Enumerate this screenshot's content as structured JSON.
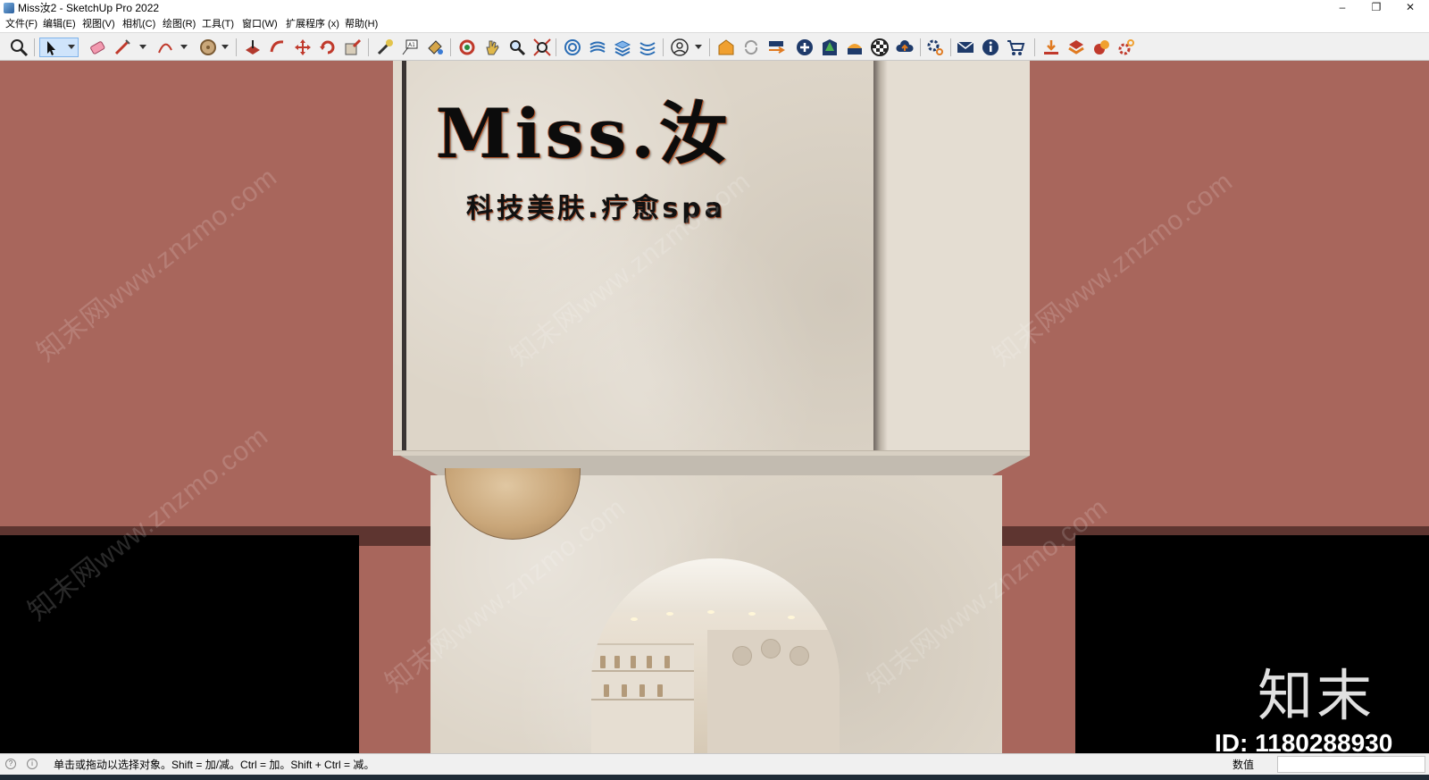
{
  "window": {
    "title": "Miss汝2 - SketchUp Pro 2022",
    "minimize": "–",
    "restore": "❐",
    "close": "✕"
  },
  "menu": [
    "文件(F)",
    "编辑(E)",
    "视图(V)",
    "相机(C)",
    "绘图(R)",
    "工具(T)",
    "窗口(W)",
    "扩展程序 (x)",
    "帮助(H)"
  ],
  "toolbar_icons": [
    "zoom-icon",
    "select-icon",
    "eraser-icon",
    "pencil-icon",
    "arc-icon",
    "circle-icon",
    "push-pull-icon",
    "offset-icon",
    "move-icon",
    "rotate-icon",
    "scale-icon",
    "tape-measure-icon",
    "text-icon",
    "paint-bucket-icon",
    "orbit-icon",
    "pan-icon",
    "zoom-extents-icon",
    "zoom-window-icon",
    "section-plane-icon",
    "sandbox-icon",
    "layers-icon",
    "styles-icon",
    "account-icon",
    "warehouse-icon",
    "sync-icon",
    "export-icon",
    "add-icon",
    "tree-icon",
    "material-icon",
    "checker-icon",
    "cloud-upload-icon",
    "settings-icon",
    "mail-icon",
    "info-icon",
    "cart-icon",
    "import-icon",
    "component-icon",
    "render-icon",
    "gear-plugin-icon"
  ],
  "scene": {
    "logo": "Miss.汝",
    "tagline": "科技美肤.疗愈spa",
    "watermark_text": "知末网www.znzmo.com",
    "brand": "知末",
    "id_label": "ID: 1180288930"
  },
  "status": {
    "hint": "单击或拖动以选择对象。Shift = 加/减。Ctrl = 加。Shift + Ctrl = 减。",
    "measurements_label": "数值",
    "measurements_value": ""
  },
  "colors": {
    "wall": "#a8665c",
    "band": "#5e3530",
    "stone": "#ddd5c8",
    "panel": "#000000"
  }
}
